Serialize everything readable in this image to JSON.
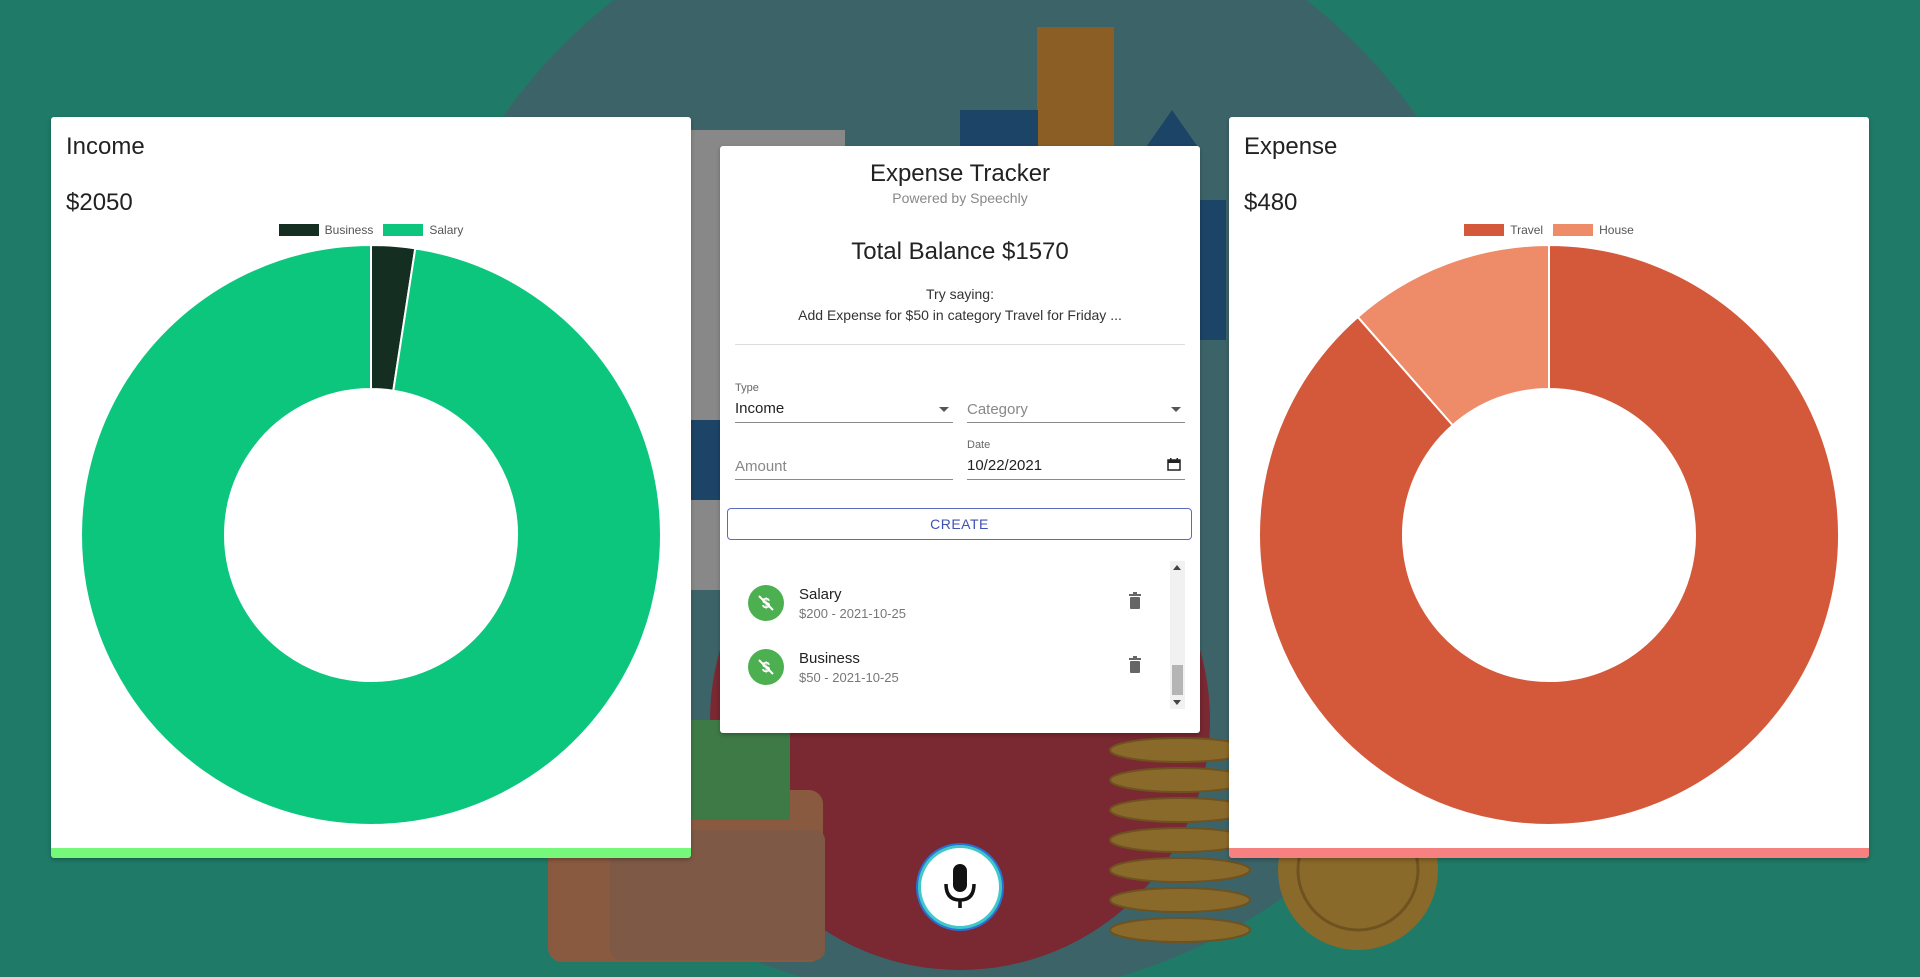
{
  "income": {
    "title": "Income",
    "total": "$2050",
    "legend": [
      {
        "label": "Business",
        "color": "#152e22"
      },
      {
        "label": "Salary",
        "color": "#0dc67e"
      }
    ],
    "accent": "#76f87a"
  },
  "expense": {
    "title": "Expense",
    "total": "$480",
    "legend": [
      {
        "label": "Travel",
        "color": "#d4593a"
      },
      {
        "label": "House",
        "color": "#ee8b68"
      }
    ],
    "accent": "#f78080"
  },
  "chart_data": [
    {
      "type": "pie",
      "title": "Income",
      "categories": [
        "Business",
        "Salary"
      ],
      "values": [
        50,
        2000
      ],
      "colors": [
        "#152e22",
        "#0dc67e"
      ],
      "legend": "top"
    },
    {
      "type": "pie",
      "title": "Expense",
      "categories": [
        "Travel",
        "House"
      ],
      "values": [
        425,
        55
      ],
      "colors": [
        "#d4593a",
        "#ee8b68"
      ],
      "legend": "top"
    }
  ],
  "tracker": {
    "title": "Expense Tracker",
    "subtitle": "Powered by Speechly",
    "balance": "Total Balance $1570",
    "try_label": "Try saying:",
    "try_command": "Add Expense for $50 in category Travel for Friday ...",
    "form": {
      "type_label": "Type",
      "type_value": "Income",
      "category_placeholder": "Category",
      "amount_placeholder": "Amount",
      "date_label": "Date",
      "date_value": "10/22/2021"
    },
    "create_label": "CREATE",
    "transactions": [
      {
        "category": "Salary",
        "detail": "$200 - 2021-10-25"
      },
      {
        "category": "Business",
        "detail": "$50 - 2021-10-25"
      }
    ]
  },
  "icons": {
    "transaction": "money-off-icon",
    "delete": "trash-icon",
    "mic": "microphone-icon",
    "calendar": "calendar-icon"
  }
}
